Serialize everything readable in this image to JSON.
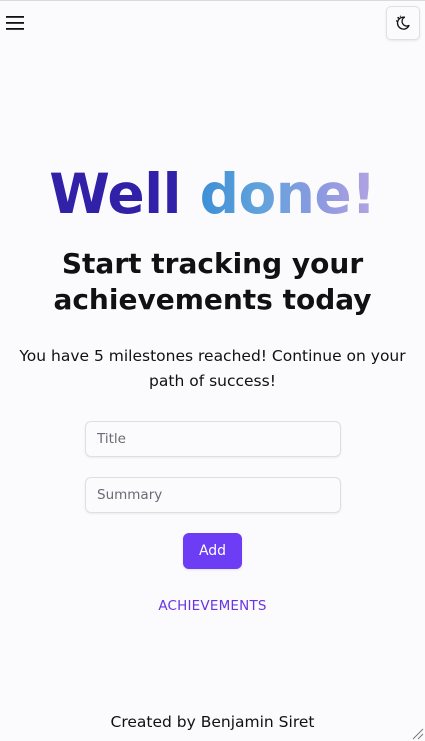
{
  "header": {
    "menu_icon": "hamburger-menu-icon",
    "theme_icon": "moon-theme-icon"
  },
  "hero": {
    "title_word_1": "Well",
    "title_word_2": "done!",
    "subtitle": "Start tracking your achievements today",
    "message": "You have 5 milestones reached! Continue on your path of success!",
    "milestones_count": 5
  },
  "form": {
    "title_placeholder": "Title",
    "title_value": "",
    "summary_placeholder": "Summary",
    "summary_value": "",
    "add_label": "Add"
  },
  "nav": {
    "achievements_label": "ACHIEVEMENTS"
  },
  "footer": {
    "credit": "Created by Benjamin Siret"
  },
  "colors": {
    "background": "#fbfafc",
    "title_primary": "#3120a8",
    "title_gradient_start": "#3d8fd6",
    "title_gradient_end": "#b5a3e2",
    "accent_button": "#6d3cf5",
    "link": "#6a35e0"
  }
}
